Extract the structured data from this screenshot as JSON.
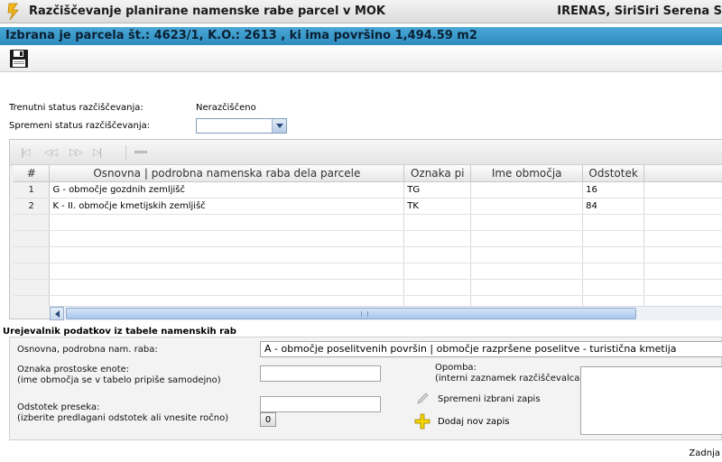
{
  "window": {
    "title": "Razčiščevanje planirane namenske rabe parcel v MOK",
    "user": "IRENAS, SiriSiri Serena S"
  },
  "selection_bar": {
    "text": "Izbrana je parcela št.: 4623/1, K.O.: 2613 , ki ima površino 1,494.59 m2"
  },
  "toolbar": {
    "save_icon": "floppy-disk-icon"
  },
  "status": {
    "current_label": "Trenutni status razčiščevanja:",
    "current_value": "Nerazčiščeno",
    "change_label": "Spremeni status razčiščevanja:",
    "change_value": ""
  },
  "grid": {
    "nav_icons": [
      "first-page-icon",
      "previous-page-icon",
      "next-page-icon",
      "last-page-icon",
      "delete-row-icon"
    ],
    "columns": [
      "#",
      "Osnovna | podrobna namenska raba dela parcele",
      "Oznaka pi",
      "Ime območja",
      "Odstotek"
    ],
    "rows": [
      {
        "n": "1",
        "raba": "G - območje gozdnih zemljišč",
        "oznaka": "TG",
        "ime": "",
        "odstotek": "16"
      },
      {
        "n": "2",
        "raba": "K - II. območje kmetijskih zemljišč",
        "oznaka": "TK",
        "ime": "",
        "odstotek": "84"
      }
    ]
  },
  "editor": {
    "title": "Urejevalnik podatkov iz tabele namenskih rab",
    "raba_label": "Osnovna, podrobna nam. raba:",
    "raba_value": "A - območje poselitvenih površin | območje razpršene poselitve - turistična kmetija",
    "oznaka_label": "Oznaka prostoske enote:",
    "oznaka_hint": "(ime območja se v tabelo pripiše samodejno)",
    "oznaka_value": "",
    "odstotek_label": "Odstotek preseka:",
    "odstotek_hint": "(izberite predlagani odstotek ali vnesite ročno)",
    "odstotek_value": "",
    "odstotek_button": "0",
    "opomba_label": "Opomba:",
    "opomba_hint": "(interni zaznamek razčiščevalca)",
    "opomba_value": "",
    "update_label": "Spremeni izbrani zapis",
    "add_label": "Dodaj nov zapis"
  },
  "footer": {
    "text": "Zadnja"
  },
  "colors": {
    "selection_bar": "#3b9ccc",
    "scroll_thumb": "#a9c6ec"
  }
}
